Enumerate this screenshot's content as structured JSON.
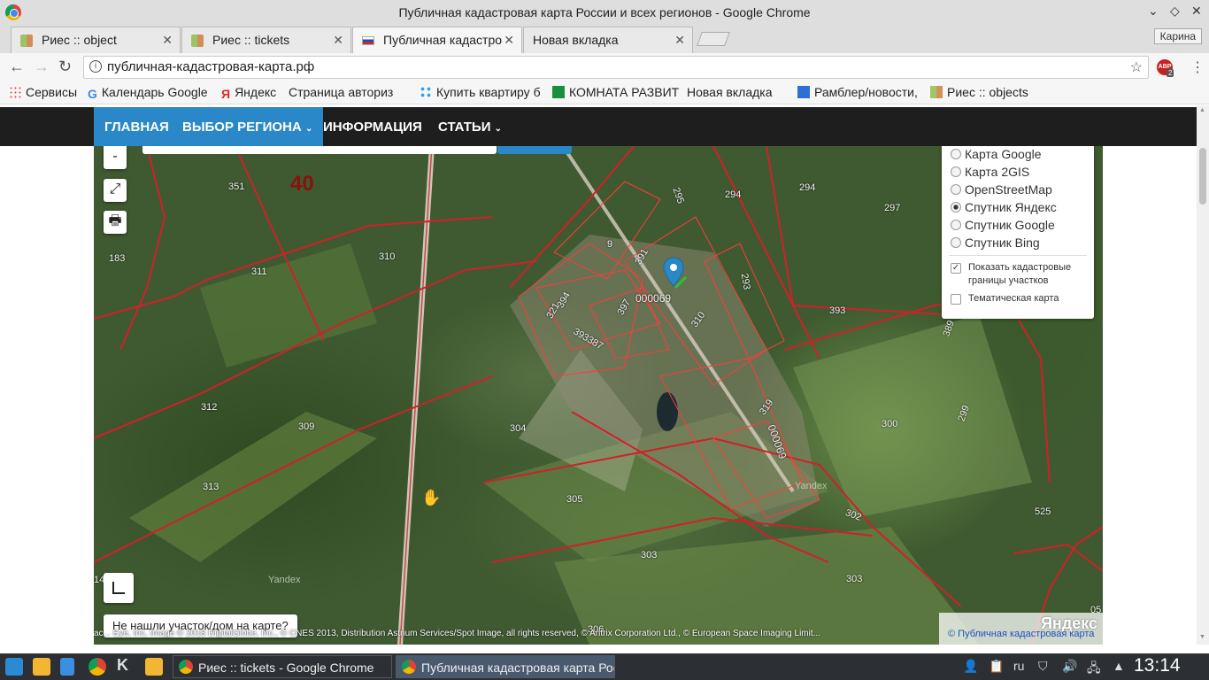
{
  "window": {
    "title": "Публичная кадастровая карта России и всех регионов - Google Chrome",
    "profile": "Карина"
  },
  "tabs": [
    {
      "label": "Риес :: object",
      "active": false
    },
    {
      "label": "Риес :: tickets",
      "active": false
    },
    {
      "label": "Публичная кадастро",
      "active": true
    },
    {
      "label": "Новая вкладка",
      "active": false
    }
  ],
  "toolbar": {
    "url": "публичная-кадастровая-карта.рф",
    "adblock_badge": "ABP",
    "adblock_count": "2"
  },
  "bookmarks": [
    {
      "label": "Сервисы",
      "icon": "apps-icon"
    },
    {
      "label": "Календарь Google",
      "icon": "google-icon"
    },
    {
      "label": "Яндекс",
      "icon": "yandex-icon"
    },
    {
      "label": "Страница авториз",
      "icon": "page-icon"
    },
    {
      "label": "Купить квартиру б",
      "icon": "drops-icon"
    },
    {
      "label": "КОМНАТА РАЗВИТ",
      "icon": "green-icon"
    },
    {
      "label": "Новая вкладка",
      "icon": "page-icon"
    },
    {
      "label": "Рамблер/новости,",
      "icon": "rambler-icon"
    },
    {
      "label": "Риес :: objects",
      "icon": "grid-icon"
    }
  ],
  "site_nav": {
    "home": "ГЛАВНАЯ",
    "region": "ВЫБОР РЕГИОНА",
    "info": "ИНФОРМАЦИЯ",
    "articles": "СТАТЬИ"
  },
  "map": {
    "controls": {
      "zoom_out": "-",
      "fullscreen": "⤢",
      "print": "🖶"
    },
    "layers": [
      {
        "label": "Карта Google",
        "selected": false
      },
      {
        "label": "Карта 2GIS",
        "selected": false
      },
      {
        "label": "OpenStreetMap",
        "selected": false
      },
      {
        "label": "Спутник Яндекс",
        "selected": true
      },
      {
        "label": "Спутник Google",
        "selected": false
      },
      {
        "label": "Спутник Bing",
        "selected": false
      }
    ],
    "show_cadastral": {
      "label": "Показать кадастровые границы участков",
      "checked": true
    },
    "thematic": {
      "label": "Тематическая карта",
      "checked": false
    },
    "block_number": "40",
    "parcels": [
      "351",
      "183",
      "311",
      "310",
      "312",
      "309",
      "313",
      "304",
      "305",
      "303",
      "303",
      "306",
      "294",
      "294",
      "297",
      "293",
      "393",
      "389",
      "300",
      "299",
      "302",
      "525",
      "000069",
      "310",
      "319",
      "000069",
      "397",
      "391",
      "394",
      "321",
      "393387",
      "295",
      "14",
      "05",
      "9"
    ],
    "watermarks": [
      "Yandex",
      "Yandex"
    ],
    "not_found_button": "Не нашли участок/дом на карте?",
    "copyright": "ac... Eye, Inc, Image © 2018 DigitalGlobe, Inc., © CNES 2013, Distribution Astrium Services/Spot Image, all rights reserved, © Antrix Corporation Ltd., © European Space Imaging Limit...",
    "attribution_logo": "Яндекс",
    "attribution_link": "© Публичная кадастровая карта"
  },
  "taskbar": {
    "windows": [
      {
        "label": "Риес :: tickets - Google Chrome",
        "active": false
      },
      {
        "label": "Публичная кадастровая карта Рос",
        "active": true
      }
    ],
    "lang": "ru",
    "clock": "13:14"
  }
}
